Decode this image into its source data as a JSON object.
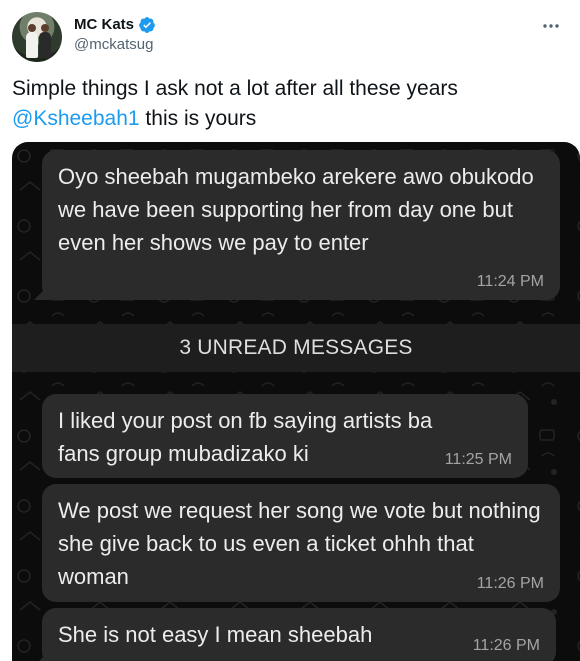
{
  "tweet": {
    "display_name": "MC Kats",
    "handle": "@mckatsug",
    "text_line1": "Simple things I ask not a lot after all these years",
    "mention": "@Ksheebah1",
    "text_line2_rest": " this is yours",
    "verified_color": "#1d9bf0"
  },
  "chat": {
    "messages": [
      {
        "text": "Oyo sheebah mugambeko arekere awo obukodo we have been supporting her from day one but even her shows we pay to enter",
        "time": "11:24 PM"
      },
      {
        "text": "I liked your post on fb saying artists ba fans group mubadizako ki",
        "time": "11:25 PM"
      },
      {
        "text": "We post we request her song we vote but nothing she give back to us even a ticket ohhh that woman",
        "time": "11:26 PM"
      },
      {
        "text": "She is not easy I mean sheebah",
        "time": "11:26 PM"
      }
    ],
    "unread_banner": "3 UNREAD MESSAGES"
  }
}
